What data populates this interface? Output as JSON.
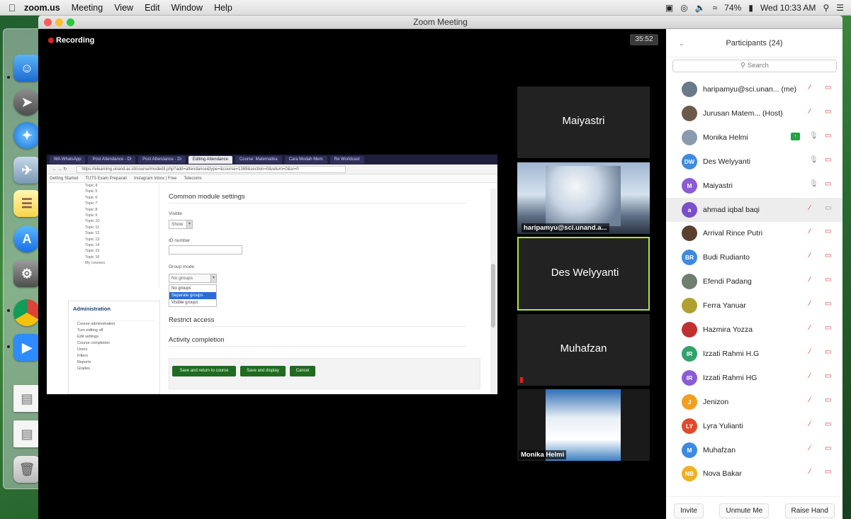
{
  "menubar": {
    "app": "zoom.us",
    "items": [
      "Meeting",
      "View",
      "Edit",
      "Window",
      "Help"
    ],
    "battery": "74%",
    "clock": "Wed 10:33 AM"
  },
  "window": {
    "title": "Zoom Meeting",
    "recording": "Recording",
    "timer": "35:52"
  },
  "shared_screen": {
    "tabs": [
      "WA WhatsApp",
      "Post Attendance - Di",
      "Post Attendance - Di",
      "Editing Attendance",
      "Course: Matematika",
      "Cara Mudah Mem",
      "Re Worldcast"
    ],
    "url": "https://elearning.unand.ac.id/course/modedit.php?add=attendance&type=&course=1369&section=0&return=0&sr=0",
    "bookmarks": [
      "Getting Started",
      "TUTS Exam Preparati",
      "Instagram Inbox | Free",
      "Telecoms"
    ],
    "nav_topics": [
      "Topic 4",
      "Topic 5",
      "Topic 6",
      "Topic 7",
      "Topic 8",
      "Topic 9",
      "Topic 10",
      "Topic 11",
      "Topic 12",
      "Topic 13",
      "Topic 14",
      "Topic 15",
      "Topic 16",
      "My courses"
    ],
    "admin": {
      "title": "Administration",
      "items": [
        "Course administration",
        "Turn editing off",
        "Edit settings",
        "Course completion",
        "Users",
        "Filters",
        "Reports",
        "Grades"
      ]
    },
    "form": {
      "section_common": "Common module settings",
      "visible_label": "Visible",
      "visible_value": "Show",
      "id_label": "ID number",
      "group_label": "Group mode",
      "group_value": "No groups",
      "group_options": [
        "No groups",
        "Separate groups",
        "Visible groups"
      ],
      "section_restrict": "Restrict access",
      "section_activity": "Activity completion",
      "btn_save_return": "Save and return to course",
      "btn_save_display": "Save and display",
      "btn_cancel": "Cancel"
    }
  },
  "video_tiles": [
    {
      "name": "Maiyastri",
      "kind": "name"
    },
    {
      "name": "haripamyu@sci.unand.a...",
      "kind": "video"
    },
    {
      "name": "Des Welyyanti",
      "kind": "name",
      "active": true
    },
    {
      "name": "Muhafzan",
      "kind": "name"
    },
    {
      "name": "Monika Helmi",
      "kind": "video"
    }
  ],
  "participants": {
    "title": "Participants (24)",
    "search_placeholder": "Search",
    "list": [
      {
        "name": "haripamyu@sci.unan... (me)",
        "initials": "",
        "color": "#6a7a8a",
        "mic": "muted",
        "cam": "off"
      },
      {
        "name": "Jurusan Matem... (Host)",
        "initials": "",
        "color": "#6b5a4a",
        "mic": "muted",
        "cam": "off"
      },
      {
        "name": "Monika Helmi",
        "initials": "",
        "color": "#8a9bb0",
        "mic": "on",
        "cam": "off",
        "sharing": true
      },
      {
        "name": "Des Welyyanti",
        "initials": "DW",
        "color": "#3d8be0",
        "mic": "on",
        "cam": "off"
      },
      {
        "name": "Maiyastri",
        "initials": "M",
        "color": "#8b5cd6",
        "mic": "on",
        "cam": "off"
      },
      {
        "name": "ahmad iqbal baqi",
        "initials": "a",
        "color": "#7a4fc9",
        "mic": "muted",
        "cam": "on"
      },
      {
        "name": "Arrival Rince Putri",
        "initials": "",
        "color": "#5a4030",
        "mic": "muted",
        "cam": "off"
      },
      {
        "name": "Budi Rudianto",
        "initials": "BR",
        "color": "#3d8be0",
        "mic": "muted",
        "cam": "off"
      },
      {
        "name": "Efendi Padang",
        "initials": "",
        "color": "#6f7f6f",
        "mic": "muted",
        "cam": "off"
      },
      {
        "name": "Ferra Yanuar",
        "initials": "",
        "color": "#b0a030",
        "mic": "muted",
        "cam": "off"
      },
      {
        "name": "Hazmira Yozza",
        "initials": "",
        "color": "#c03030",
        "mic": "muted",
        "cam": "off"
      },
      {
        "name": "Izzati Rahmi H.G",
        "initials": "IR",
        "color": "#2fa36b",
        "mic": "muted",
        "cam": "off"
      },
      {
        "name": "Izzati Rahmi HG",
        "initials": "IR",
        "color": "#8b5cd6",
        "mic": "muted",
        "cam": "off"
      },
      {
        "name": "Jenizon",
        "initials": "J",
        "color": "#f0a020",
        "mic": "muted",
        "cam": "off"
      },
      {
        "name": "Lyra Yulianti",
        "initials": "LY",
        "color": "#e04a2a",
        "mic": "muted",
        "cam": "off"
      },
      {
        "name": "Muhafzan",
        "initials": "M",
        "color": "#3d8be0",
        "mic": "muted",
        "cam": "off"
      },
      {
        "name": "Nova Bakar",
        "initials": "NB",
        "color": "#f0b020",
        "mic": "muted",
        "cam": "off"
      }
    ],
    "footer": [
      "Invite",
      "Unmute Me",
      "Raise Hand"
    ]
  }
}
